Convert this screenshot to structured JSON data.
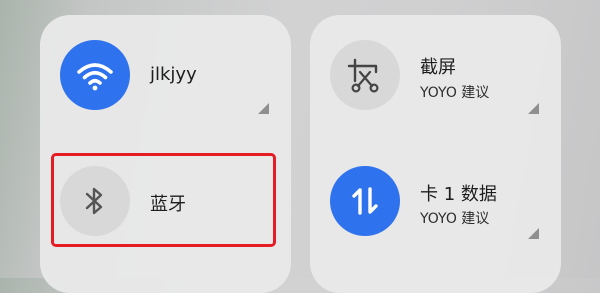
{
  "panels": {
    "connectivity": {
      "wifi": {
        "label": "jlkjyy",
        "icon": "wifi-icon",
        "state": "on"
      },
      "bluetooth": {
        "label": "蓝牙",
        "icon": "bluetooth-icon",
        "state": "off"
      }
    },
    "shortcuts": {
      "screenshot": {
        "label": "截屏",
        "sublabel": "YOYO 建议",
        "icon": "screenshot-icon",
        "state": "off"
      },
      "mobile_data": {
        "label": "卡 1 数据",
        "sublabel": "YOYO 建议",
        "icon": "data-transfer-icon",
        "state": "on"
      }
    }
  },
  "colors": {
    "active": "#2f72ee",
    "inactive": "#d8d8d8",
    "panel": "#e9e9e9",
    "highlight": "#e51c23"
  }
}
